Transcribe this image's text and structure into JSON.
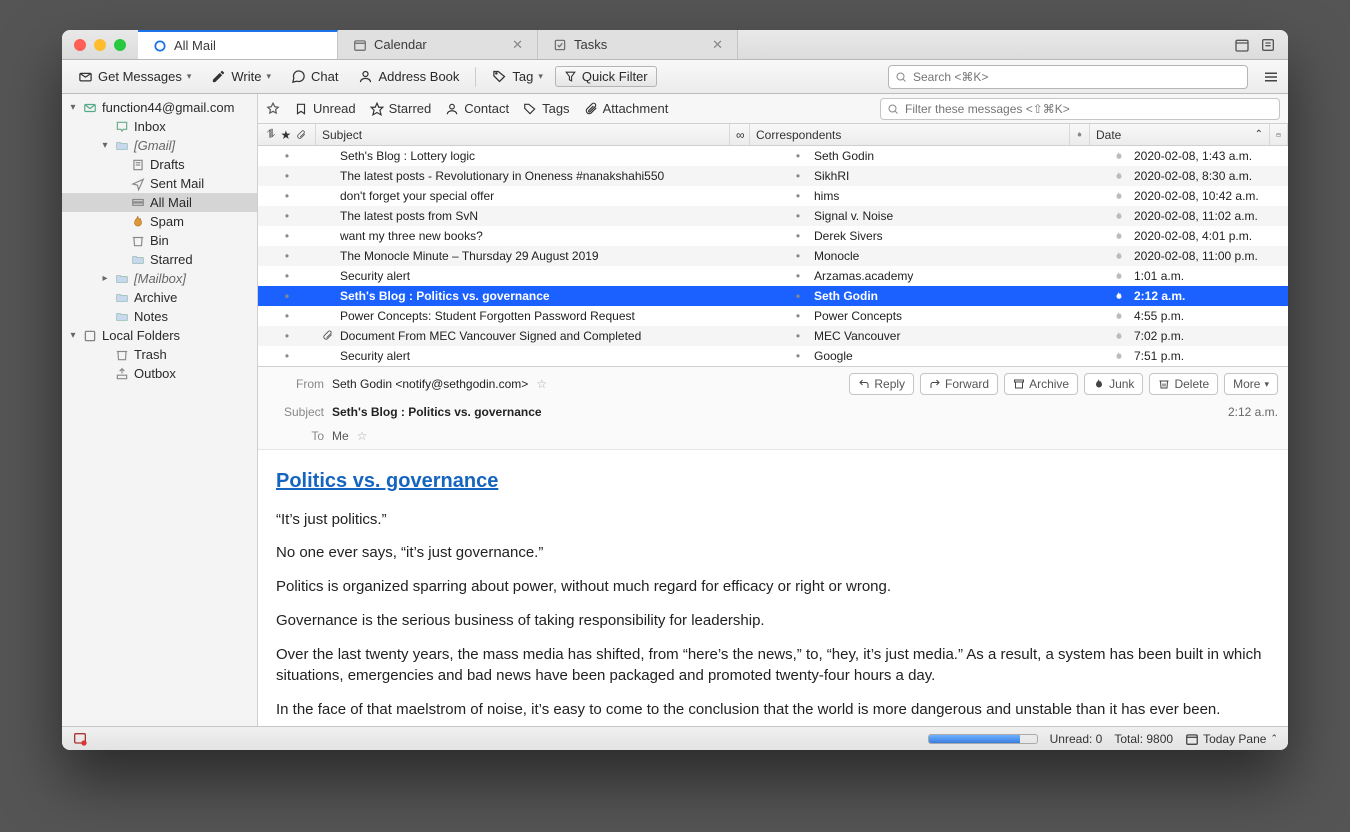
{
  "tabs": [
    {
      "label": "All Mail",
      "active": true,
      "icon": "ring"
    },
    {
      "label": "Calendar",
      "active": false,
      "icon": "calendar"
    },
    {
      "label": "Tasks",
      "active": false,
      "icon": "tasks"
    }
  ],
  "toolbar": {
    "get_messages": "Get Messages",
    "write": "Write",
    "chat": "Chat",
    "address_book": "Address Book",
    "tag": "Tag",
    "quick_filter": "Quick Filter",
    "search_placeholder": "Search <⌘K>"
  },
  "sidebar": {
    "account": "function44@gmail.com",
    "items": [
      {
        "label": "Inbox",
        "icon": "inbox",
        "indent": 2
      },
      {
        "label": "[Gmail]",
        "icon": "folder",
        "indent": 2,
        "arrow": "down",
        "italic": true
      },
      {
        "label": "Drafts",
        "icon": "drafts",
        "indent": 3
      },
      {
        "label": "Sent Mail",
        "icon": "sent",
        "indent": 3
      },
      {
        "label": "All Mail",
        "icon": "allmail",
        "indent": 3,
        "selected": true
      },
      {
        "label": "Spam",
        "icon": "spam",
        "indent": 3
      },
      {
        "label": "Bin",
        "icon": "trash",
        "indent": 3
      },
      {
        "label": "Starred",
        "icon": "folder",
        "indent": 3
      },
      {
        "label": "[Mailbox]",
        "icon": "folder",
        "indent": 2,
        "arrow": "right",
        "italic": true
      },
      {
        "label": "Archive",
        "icon": "folder",
        "indent": 2
      },
      {
        "label": "Notes",
        "icon": "folder",
        "indent": 2
      }
    ],
    "local_label": "Local Folders",
    "local": [
      {
        "label": "Trash",
        "icon": "trash",
        "indent": 2
      },
      {
        "label": "Outbox",
        "icon": "outbox",
        "indent": 2
      }
    ]
  },
  "filters": {
    "unread": "Unread",
    "starred": "Starred",
    "contact": "Contact",
    "tags": "Tags",
    "attachment": "Attachment",
    "placeholder": "Filter these messages <⇧⌘K>"
  },
  "columns": {
    "subject": "Subject",
    "correspondents": "Correspondents",
    "date": "Date"
  },
  "messages": [
    {
      "subject": "Seth's Blog : Lottery logic",
      "from": "Seth Godin",
      "date": "2020-02-08, 1:43 a.m."
    },
    {
      "subject": "The latest posts - Revolutionary in Oneness #nanakshahi550",
      "from": "SikhRI",
      "date": "2020-02-08, 8:30 a.m."
    },
    {
      "subject": "don't forget your special offer",
      "from": "hims",
      "date": "2020-02-08, 10:42 a.m."
    },
    {
      "subject": "The latest posts from SvN",
      "from": "Signal v. Noise",
      "date": "2020-02-08, 11:02 a.m."
    },
    {
      "subject": "want my three new books?",
      "from": "Derek Sivers",
      "date": "2020-02-08, 4:01 p.m."
    },
    {
      "subject": "The Monocle Minute – Thursday 29 August 2019",
      "from": "Monocle",
      "date": "2020-02-08, 11:00 p.m."
    },
    {
      "subject": "Security alert",
      "from": "Arzamas.academy",
      "date": "1:01 a.m."
    },
    {
      "subject": "Seth's Blog : Politics vs. governance",
      "from": "Seth Godin",
      "date": "2:12 a.m.",
      "selected": true
    },
    {
      "subject": "Power Concepts: Student Forgotten Password Request",
      "from": "Power Concepts",
      "date": "4:55 p.m."
    },
    {
      "subject": "Document From MEC Vancouver Signed and Completed",
      "from": "MEC Vancouver",
      "date": "7:02 p.m.",
      "attachment": true
    },
    {
      "subject": "Security alert",
      "from": "Google",
      "date": "7:51 p.m."
    }
  ],
  "preview": {
    "from_label": "From",
    "from": "Seth Godin <notify@sethgodin.com>",
    "subject_label": "Subject",
    "subject": "Seth's Blog : Politics vs. governance",
    "to_label": "To",
    "to": "Me",
    "time": "2:12 a.m.",
    "actions": {
      "reply": "Reply",
      "forward": "Forward",
      "archive": "Archive",
      "junk": "Junk",
      "delete": "Delete",
      "more": "More"
    },
    "title": "Politics vs. governance",
    "paras": [
      "“It’s just politics.”",
      "No one ever says, “it’s just governance.”",
      "Politics is organized sparring about power, without much regard for efficacy or right or wrong.",
      "Governance is the serious business of taking responsibility for leadership.",
      "Over the last twenty years, the mass media has shifted, from “here’s the news,” to, “hey, it’s just media.” As a result, a system has been built in which situations, emergencies and bad news have been packaged and promoted twenty-four hours a day.",
      "In the face of that maelstrom of noise, it’s easy to come to the conclusion that the world is more dangerous and unstable than it has ever been."
    ]
  },
  "status": {
    "unread": "Unread: 0",
    "total": "Total: 9800",
    "today": "Today Pane"
  }
}
